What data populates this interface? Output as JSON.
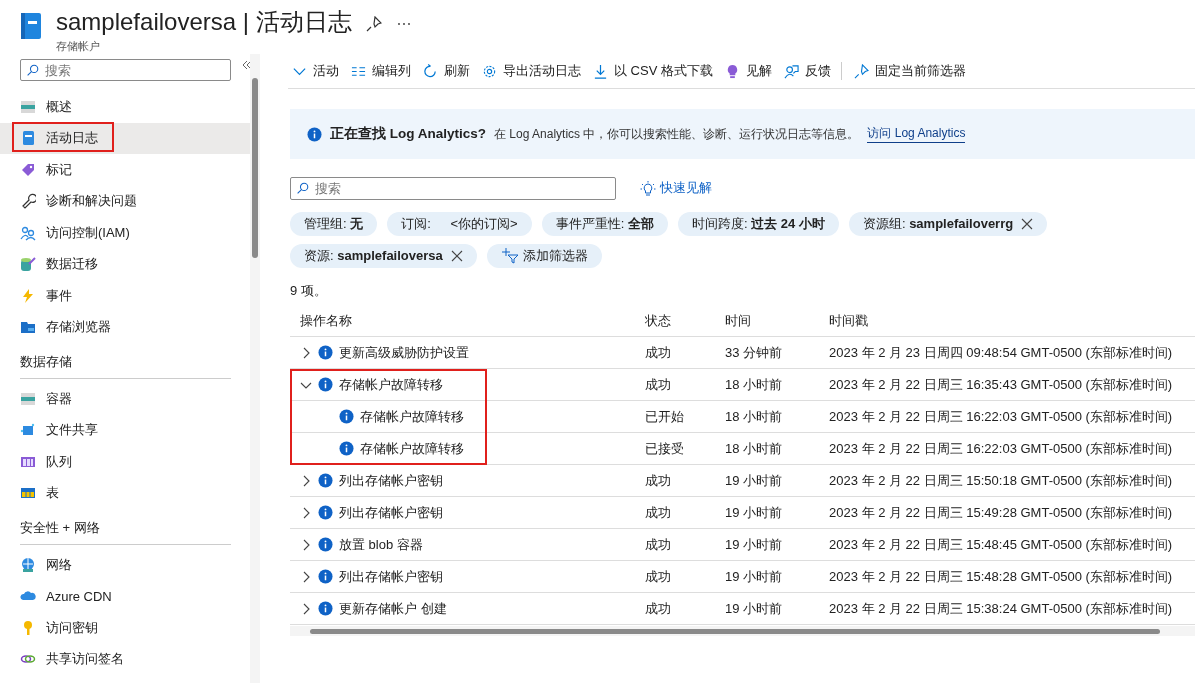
{
  "header": {
    "title": "samplefailoversa | 活动日志",
    "subtitle": "存储帐户"
  },
  "sidebar": {
    "search_placeholder": "搜索",
    "sections": [
      {
        "items": [
          {
            "label": "概述",
            "selected": false,
            "highlighted": false
          },
          {
            "label": "活动日志",
            "selected": true,
            "highlighted": true
          },
          {
            "label": "标记",
            "selected": false,
            "highlighted": false
          },
          {
            "label": "诊断和解决问题",
            "selected": false,
            "highlighted": false
          },
          {
            "label": "访问控制(IAM)",
            "selected": false,
            "highlighted": false
          },
          {
            "label": "数据迁移",
            "selected": false,
            "highlighted": false
          },
          {
            "label": "事件",
            "selected": false,
            "highlighted": false
          },
          {
            "label": "存储浏览器",
            "selected": false,
            "highlighted": false
          }
        ]
      },
      {
        "heading": "数据存储",
        "items": [
          {
            "label": "容器",
            "selected": false,
            "highlighted": false
          },
          {
            "label": "文件共享",
            "selected": false,
            "highlighted": false
          },
          {
            "label": "队列",
            "selected": false,
            "highlighted": false
          },
          {
            "label": "表",
            "selected": false,
            "highlighted": false
          }
        ]
      },
      {
        "heading": "安全性 + 网络",
        "items": [
          {
            "label": "网络",
            "selected": false,
            "highlighted": false
          },
          {
            "label": "Azure CDN",
            "selected": false,
            "highlighted": false
          },
          {
            "label": "访问密钥",
            "selected": false,
            "highlighted": false
          },
          {
            "label": "共享访问签名",
            "selected": false,
            "highlighted": false
          }
        ]
      }
    ]
  },
  "toolbar": [
    {
      "label": "活动"
    },
    {
      "label": "编辑列"
    },
    {
      "label": "刷新"
    },
    {
      "label": "导出活动日志"
    },
    {
      "label": "以 CSV 格式下载"
    },
    {
      "label": "见解"
    },
    {
      "label": "反馈"
    },
    {
      "label": "固定当前筛选器"
    }
  ],
  "banner": {
    "title": "正在查找 Log Analytics?",
    "text": "在 Log Analytics 中，你可以搜索性能、诊断、运行状况日志等信息。",
    "link": "访问 Log Analytics"
  },
  "filters": {
    "search_placeholder": "搜索",
    "quick_insights": "快速见解",
    "chips": [
      {
        "label": "管理组:",
        "value": "无",
        "bold": true,
        "removable": false
      },
      {
        "label": "订阅:",
        "value": "<你的订阅>",
        "bold": false,
        "removable": false
      },
      {
        "label": "事件严重性:",
        "value": "全部",
        "bold": true,
        "removable": false
      },
      {
        "label": "时间跨度:",
        "value": "过去 24 小时",
        "bold": true,
        "removable": false
      },
      {
        "label": "资源组:",
        "value": "samplefailoverrg",
        "bold": true,
        "removable": true
      },
      {
        "label": "资源:",
        "value": "samplefailoversa",
        "bold": true,
        "removable": true
      }
    ],
    "add_filter": "添加筛选器"
  },
  "count": "9 项。",
  "table": {
    "columns": [
      "操作名称",
      "状态",
      "时间",
      "时间戳"
    ],
    "rows": [
      {
        "name": "更新高级威胁防护设置",
        "status": "成功",
        "time": "33 分钟前",
        "timestamp": "2023 年 2 月 23 日周四 09:48:54 GMT-0500 (东部标准时间)",
        "expanded": false,
        "highlighted": false
      },
      {
        "name": "存储帐户故障转移",
        "status": "成功",
        "time": "18 小时前",
        "timestamp": "2023 年 2 月 22 日周三 16:35:43 GMT-0500 (东部标准时间)",
        "expanded": true,
        "highlighted": true,
        "children": [
          {
            "name": "存储帐户故障转移",
            "status": "已开始",
            "time": "18 小时前",
            "timestamp": "2023 年 2 月 22 日周三 16:22:03 GMT-0500 (东部标准时间)"
          },
          {
            "name": "存储帐户故障转移",
            "status": "已接受",
            "time": "18 小时前",
            "timestamp": "2023 年 2 月 22 日周三 16:22:03 GMT-0500 (东部标准时间)"
          }
        ]
      },
      {
        "name": "列出存储帐户密钥",
        "status": "成功",
        "time": "19 小时前",
        "timestamp": "2023 年 2 月 22 日周三 15:50:18 GMT-0500 (东部标准时间)",
        "expanded": false,
        "highlighted": false
      },
      {
        "name": "列出存储帐户密钥",
        "status": "成功",
        "time": "19 小时前",
        "timestamp": "2023 年 2 月 22 日周三 15:49:28 GMT-0500 (东部标准时间)",
        "expanded": false,
        "highlighted": false
      },
      {
        "name": "放置 blob 容器",
        "status": "成功",
        "time": "19 小时前",
        "timestamp": "2023 年 2 月 22 日周三 15:48:45 GMT-0500 (东部标准时间)",
        "expanded": false,
        "highlighted": false
      },
      {
        "name": "列出存储帐户密钥",
        "status": "成功",
        "time": "19 小时前",
        "timestamp": "2023 年 2 月 22 日周三 15:48:28 GMT-0500 (东部标准时间)",
        "expanded": false,
        "highlighted": false
      },
      {
        "name": "更新存储帐户 创建",
        "status": "成功",
        "time": "19 小时前",
        "timestamp": "2023 年 2 月 22 日周三 15:38:24 GMT-0500 (东部标准时间)",
        "expanded": false,
        "highlighted": false
      }
    ]
  }
}
